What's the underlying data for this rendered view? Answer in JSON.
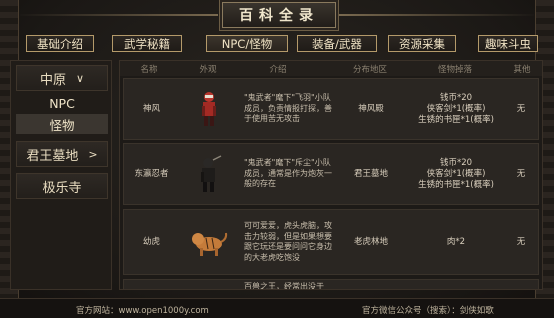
{
  "header": {
    "title": "百科全录"
  },
  "tabs": [
    {
      "label": "基础介绍",
      "active": false
    },
    {
      "label": "武学秘籍",
      "active": false
    },
    {
      "label": "NPC/怪物",
      "active": true
    },
    {
      "label": "装备/武器",
      "active": false
    },
    {
      "label": "资源采集",
      "active": false
    },
    {
      "label": "趣味斗虫",
      "active": false
    }
  ],
  "sidebar": {
    "region": "中原",
    "subs": [
      "NPC",
      "怪物"
    ],
    "others": [
      "君王墓地",
      "极乐寺"
    ]
  },
  "table": {
    "headers": [
      "名称",
      "外观",
      "介绍",
      "分布地区",
      "怪物掉落",
      "其他"
    ],
    "rows": [
      {
        "name": "神风",
        "desc": "\"鬼武者\"麾下\"飞羽\"小队成员，负责情报打探，善于使用苦无攻击",
        "area": "神风殿",
        "drops": [
          "钱币*20",
          "侠客剑*1(概率)",
          "生锈的书匣*1(概率)"
        ],
        "other": "无"
      },
      {
        "name": "东瀛忍者",
        "desc": "\"鬼武者\"麾下\"斥尘\"小队成员，通常是作为炮灰一般的存在",
        "area": "君王墓地",
        "drops": [
          "钱币*20",
          "侠客剑*1(概率)",
          "生锈的书匣*1(概率)"
        ],
        "other": "无"
      },
      {
        "name": "幼虎",
        "desc": "可可爱爱，虎头虎脑，攻击力较弱，但是如果想要跟它玩还是要问问它身边的大老虎吃饱没",
        "area": "老虎林地",
        "drops": [
          "肉*2"
        ],
        "other": "无"
      },
      {
        "name": "",
        "desc": "百兽之王，经常出没于",
        "area": "",
        "drops": [],
        "other": ""
      }
    ]
  },
  "footer": {
    "website": "官方网站：www.open1000y.com",
    "wechat": "官方微信公众号（搜索）：剑侠如歌"
  },
  "colors": {
    "accent": "#b49a6a",
    "panel": "#2a2622",
    "text": "#d8cdb8"
  },
  "icons": {
    "region_toggle": "chevron-down-icon",
    "tomb_toggle": "chevron-right-icon"
  }
}
